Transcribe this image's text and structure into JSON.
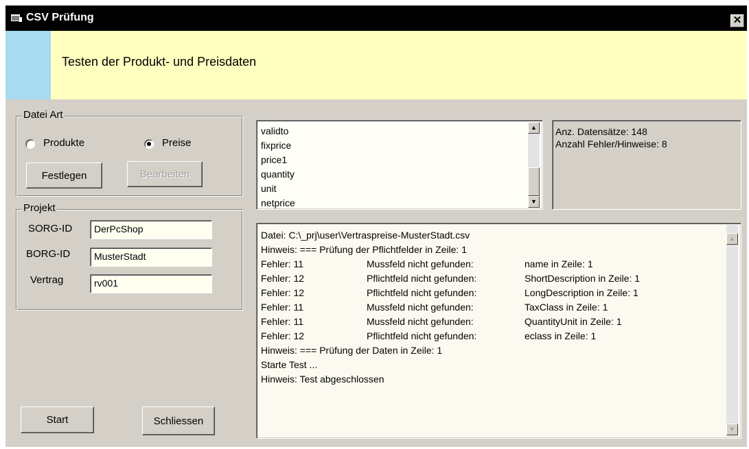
{
  "window": {
    "title": "CSV Prüfung",
    "close_glyph": "✕"
  },
  "banner": {
    "text": "Testen der Produkt- und Preisdaten"
  },
  "datei_art": {
    "legend": "Datei Art",
    "radio_produkte": "Produkte",
    "radio_preise": "Preise",
    "selected": "Preise",
    "festlegen": "Festlegen",
    "bearbeiten": "Bearbeiten"
  },
  "projekt": {
    "legend": "Projekt",
    "sorg_label": "SORG-ID",
    "sorg_value": "DerPcShop",
    "borg_label": "BORG-ID",
    "borg_value": "MusterStadt",
    "vertrag_label": "Vertrag",
    "vertrag_value": "rv001"
  },
  "buttons": {
    "start": "Start",
    "schliessen": "Schliessen"
  },
  "field_list": [
    "validto",
    "fixprice",
    "price1",
    "quantity",
    "unit",
    "netprice"
  ],
  "stats": {
    "datensaetze": "Anz. Datensätze:  148",
    "fehler": "Anzahl Fehler/Hinweise:  8"
  },
  "log": {
    "lines": [
      "Datei:  C:\\_prj\\user\\Vertraspreise-MusterStadt.csv",
      "Hinweis: === Prüfung der Pflichtfelder in Zeile: 1"
    ],
    "errors": [
      {
        "code": "Fehler:  11",
        "msg": "Mussfeld nicht gefunden:",
        "where": "name in Zeile: 1"
      },
      {
        "code": "Fehler:  12",
        "msg": "Pflichtfeld nicht gefunden:",
        "where": "ShortDescription in Zeile: 1"
      },
      {
        "code": "Fehler:  12",
        "msg": "Pflichtfeld nicht gefunden:",
        "where": "LongDescription in Zeile: 1"
      },
      {
        "code": "Fehler:  11",
        "msg": "Mussfeld nicht gefunden:",
        "where": "TaxClass in Zeile: 1"
      },
      {
        "code": "Fehler:  11",
        "msg": "Mussfeld nicht gefunden:",
        "where": "QuantityUnit in Zeile: 1"
      },
      {
        "code": "Fehler:  12",
        "msg": "Pflichtfeld nicht gefunden:",
        "where": "eclass in Zeile: 1"
      }
    ],
    "tail": [
      "Hinweis: === Prüfung der Daten in Zeile: 1",
      "Starte Test ...",
      "Hinweis: Test abgeschlossen"
    ]
  },
  "icons": {
    "app": "app-window-icon",
    "close": "close-icon",
    "up": "scroll-up-arrow-icon",
    "down": "scroll-down-arrow-icon"
  }
}
